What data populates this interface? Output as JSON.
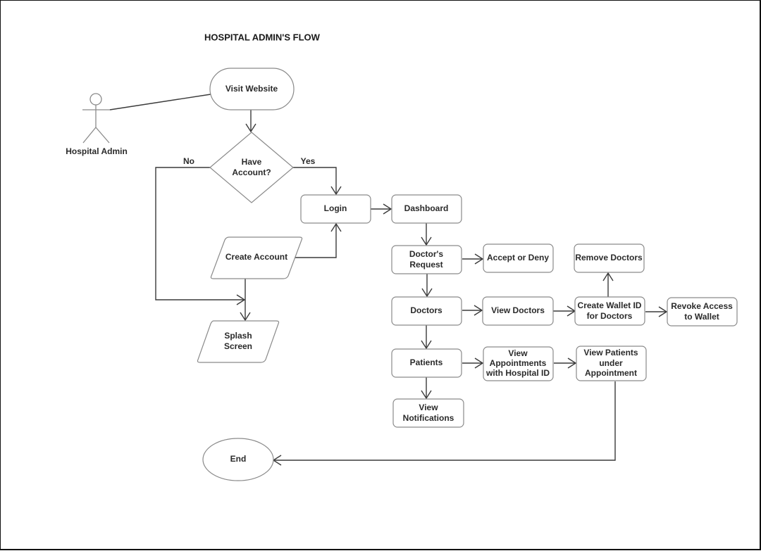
{
  "diagram": {
    "title": "HOSPITAL ADMIN'S FLOW",
    "actor": {
      "label": "Hospital Admin"
    },
    "nodes": {
      "visit_website": {
        "label": [
          "Visit Website"
        ],
        "shape": "terminator"
      },
      "have_account": {
        "label": [
          "Have",
          "Account?"
        ],
        "shape": "decision"
      },
      "login": {
        "label": [
          "Login"
        ],
        "shape": "process"
      },
      "create_account": {
        "label": [
          "Create Account"
        ],
        "shape": "data"
      },
      "splash_screen": {
        "label": [
          "Splash",
          "Screen"
        ],
        "shape": "data"
      },
      "dashboard": {
        "label": [
          "Dashboard"
        ],
        "shape": "process"
      },
      "doctors_request": {
        "label": [
          "Doctor's",
          "Request"
        ],
        "shape": "process"
      },
      "accept_or_deny": {
        "label": [
          "Accept or Deny"
        ],
        "shape": "process"
      },
      "doctors": {
        "label": [
          "Doctors"
        ],
        "shape": "process"
      },
      "view_doctors": {
        "label": [
          "View Doctors"
        ],
        "shape": "process"
      },
      "create_wallet_id": {
        "label": [
          "Create Wallet ID",
          "for Doctors"
        ],
        "shape": "process"
      },
      "remove_doctors": {
        "label": [
          "Remove Doctors"
        ],
        "shape": "process"
      },
      "revoke_access": {
        "label": [
          "Revoke Access",
          "to Wallet"
        ],
        "shape": "process"
      },
      "patients": {
        "label": [
          "Patients"
        ],
        "shape": "process"
      },
      "view_appointments": {
        "label": [
          "View",
          "Appointments",
          "with Hospital ID"
        ],
        "shape": "process"
      },
      "view_patients_under_appointment": {
        "label": [
          "View Patients",
          "under",
          "Appointment"
        ],
        "shape": "process"
      },
      "view_notifications": {
        "label": [
          "View",
          "Notifications"
        ],
        "shape": "process"
      },
      "end": {
        "label": [
          "End"
        ],
        "shape": "terminator-ellipse"
      }
    },
    "edge_labels": {
      "no": "No",
      "yes": "Yes"
    },
    "edges": [
      {
        "from": "actor",
        "to": "visit_website",
        "arrow": false
      },
      {
        "from": "visit_website",
        "to": "have_account"
      },
      {
        "from": "have_account",
        "to": "login",
        "label": "Yes"
      },
      {
        "from": "have_account",
        "to": "splash_screen",
        "label": "No"
      },
      {
        "from": "create_account",
        "to": "login"
      },
      {
        "from": "create_account",
        "to": "splash_screen"
      },
      {
        "from": "login",
        "to": "dashboard"
      },
      {
        "from": "dashboard",
        "to": "doctors_request"
      },
      {
        "from": "doctors_request",
        "to": "accept_or_deny"
      },
      {
        "from": "doctors_request",
        "to": "doctors"
      },
      {
        "from": "doctors",
        "to": "view_doctors"
      },
      {
        "from": "view_doctors",
        "to": "create_wallet_id"
      },
      {
        "from": "create_wallet_id",
        "to": "remove_doctors"
      },
      {
        "from": "create_wallet_id",
        "to": "revoke_access"
      },
      {
        "from": "doctors",
        "to": "patients"
      },
      {
        "from": "patients",
        "to": "view_appointments"
      },
      {
        "from": "view_appointments",
        "to": "view_patients_under_appointment"
      },
      {
        "from": "patients",
        "to": "view_notifications"
      },
      {
        "from": "view_patients_under_appointment",
        "to": "end"
      }
    ]
  }
}
